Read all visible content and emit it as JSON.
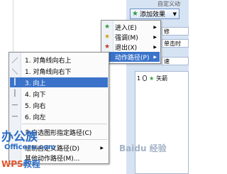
{
  "pane": {
    "title": "自定义动",
    "add_effect_label": "添加效果",
    "field_top": "修",
    "field_start": "单击时",
    "field_speed": "速",
    "list_item_num": "1",
    "list_item_label": "矢箭"
  },
  "submenu": {
    "items": [
      {
        "icon": "★",
        "label": "进入(E)"
      },
      {
        "icon": "★",
        "label": "强调(M)"
      },
      {
        "icon": "★",
        "label": "退出(X)"
      },
      {
        "icon": "☆",
        "label": "动作路径(P)"
      }
    ],
    "highlighted_index": 3
  },
  "menu": {
    "items": [
      {
        "icon": "／",
        "label": "1. 对角线向右上"
      },
      {
        "icon": "＼",
        "label": "1. 对角线向右下"
      },
      {
        "icon": "┃",
        "label": "3. 向上"
      },
      {
        "icon": "│",
        "label": "4. 向下"
      },
      {
        "icon": "—",
        "label": "5. 向右"
      },
      {
        "icon": "—",
        "label": "6. 向左"
      }
    ],
    "highlighted_index": 2,
    "custom_path_label": "为自选图形指定路径(C)",
    "draw_custom_label": "绘制自定义路径(D)",
    "other_paths_label": "其他动作路径(M)..."
  },
  "watermark": {
    "big": "办公族",
    "small": "Officezu.com",
    "wps_prefix": "WPS",
    "wps_suffix": "教程",
    "baidu": "Baidu 经验"
  },
  "colors": {
    "highlight": "#3a73c9",
    "pane_bg": "#d6e3f3"
  }
}
